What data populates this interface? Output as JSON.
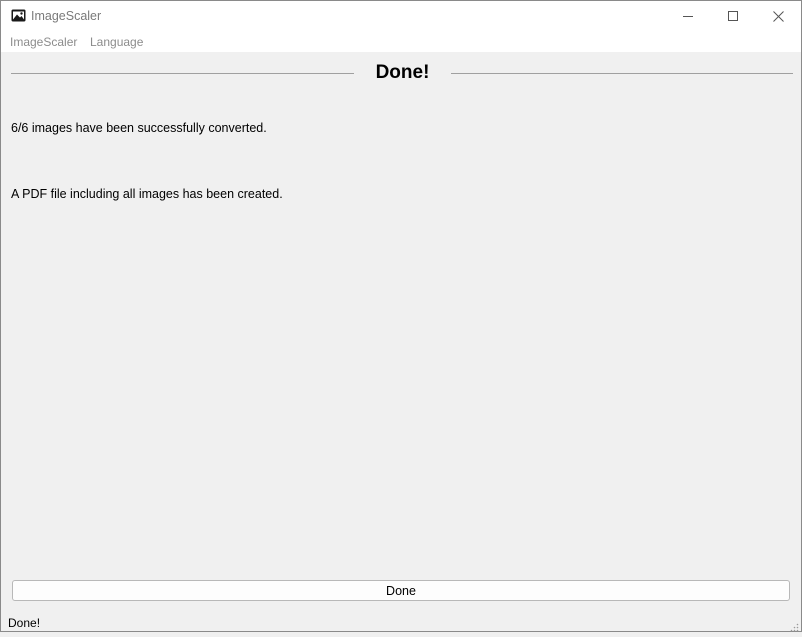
{
  "window": {
    "title": "ImageScaler"
  },
  "menu": {
    "items": [
      "ImageScaler",
      "Language"
    ]
  },
  "header": {
    "title": "Done!"
  },
  "messages": {
    "converted": "6/6 images have been successfully converted.",
    "pdf": "A PDF file including all images has been created."
  },
  "actions": {
    "done_label": "Done"
  },
  "status": {
    "text": "Done!"
  },
  "icons": {
    "app": "image-icon",
    "minimize": "minimize-icon",
    "maximize": "maximize-icon",
    "close": "close-icon",
    "grip": "resize-grip-icon"
  }
}
